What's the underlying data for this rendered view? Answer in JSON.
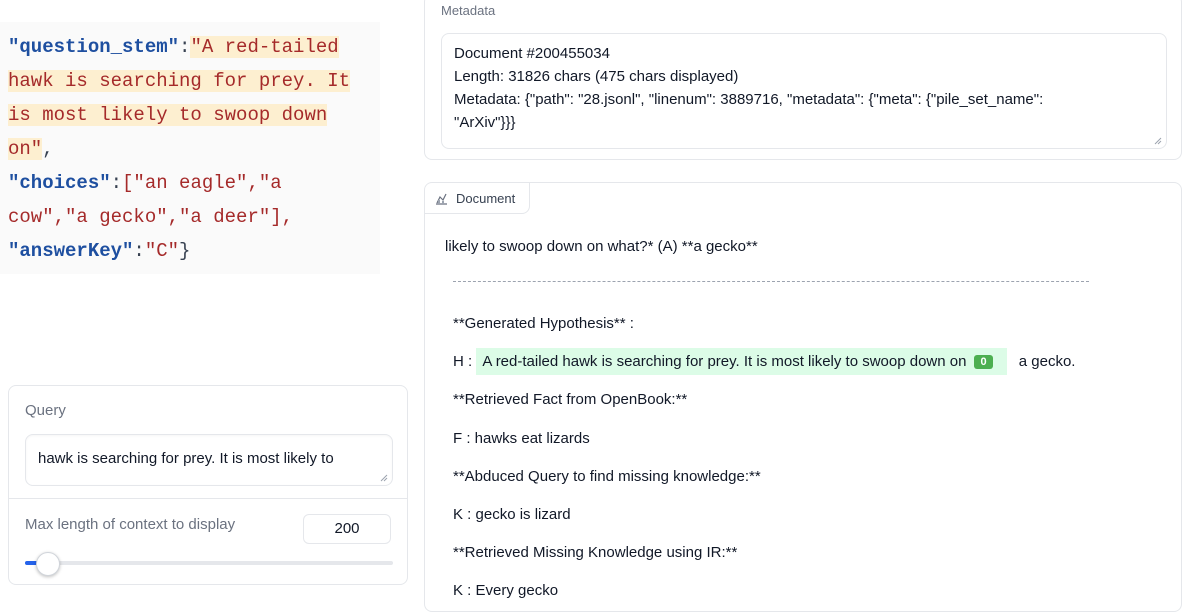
{
  "code": {
    "question_key": "\"question_stem\"",
    "question_val_1": "\"A red-tailed",
    "question_val_2": "hawk is searching for prey. It",
    "question_val_3": "is most likely to swoop down",
    "question_val_4": "on\"",
    "choices_key": "\"choices\"",
    "choices_v1": "[\"an eagle\",\"a",
    "choices_v2": "cow\",\"a gecko\",\"a deer\"],",
    "answer_key": "\"answerKey\"",
    "answer_val": "\"C\""
  },
  "query": {
    "label": "Query",
    "value": "hawk is searching for prey. It is most likely to"
  },
  "max_length": {
    "label": "Max length of context to display",
    "value": "200",
    "slider_fraction": 0.05
  },
  "metadata": {
    "label": "Metadata",
    "line1": "Document #200455034",
    "line2": "Length: 31826 chars (475 chars displayed)",
    "line3": "Metadata: {\"path\": \"28.jsonl\", \"linenum\": 3889716, \"metadata\": {\"meta\": {\"pile_set_name\":",
    "line4": "\"ArXiv\"}}}"
  },
  "document": {
    "tab_label": "Document",
    "line1": "likely to swoop down on what?* (A) **a gecko**",
    "gen_hyp": "**Generated Hypothesis** :",
    "h_prefix": "H :",
    "h_highlight": "A red-tailed hawk is searching for prey. It is most likely to swoop down on",
    "h_badge": "0",
    "h_suffix": "a gecko.",
    "retrieved_fact": "**Retrieved Fact from OpenBook:**",
    "fact": "F : hawks eat lizards",
    "abduced": "**Abduced Query to find missing knowledge:**",
    "k1": "K : gecko is lizard",
    "retrieved_missing": "**Retrieved Missing Knowledge using IR:**",
    "k2": "K : Every gecko"
  },
  "colors": {
    "code_key": "#1e4fa0",
    "code_string": "#a52a2a",
    "code_highlight": "#fdefd0",
    "hypothesis_highlight": "#dcfce7",
    "badge": "#4caf50",
    "slider_accent": "#2563eb"
  }
}
